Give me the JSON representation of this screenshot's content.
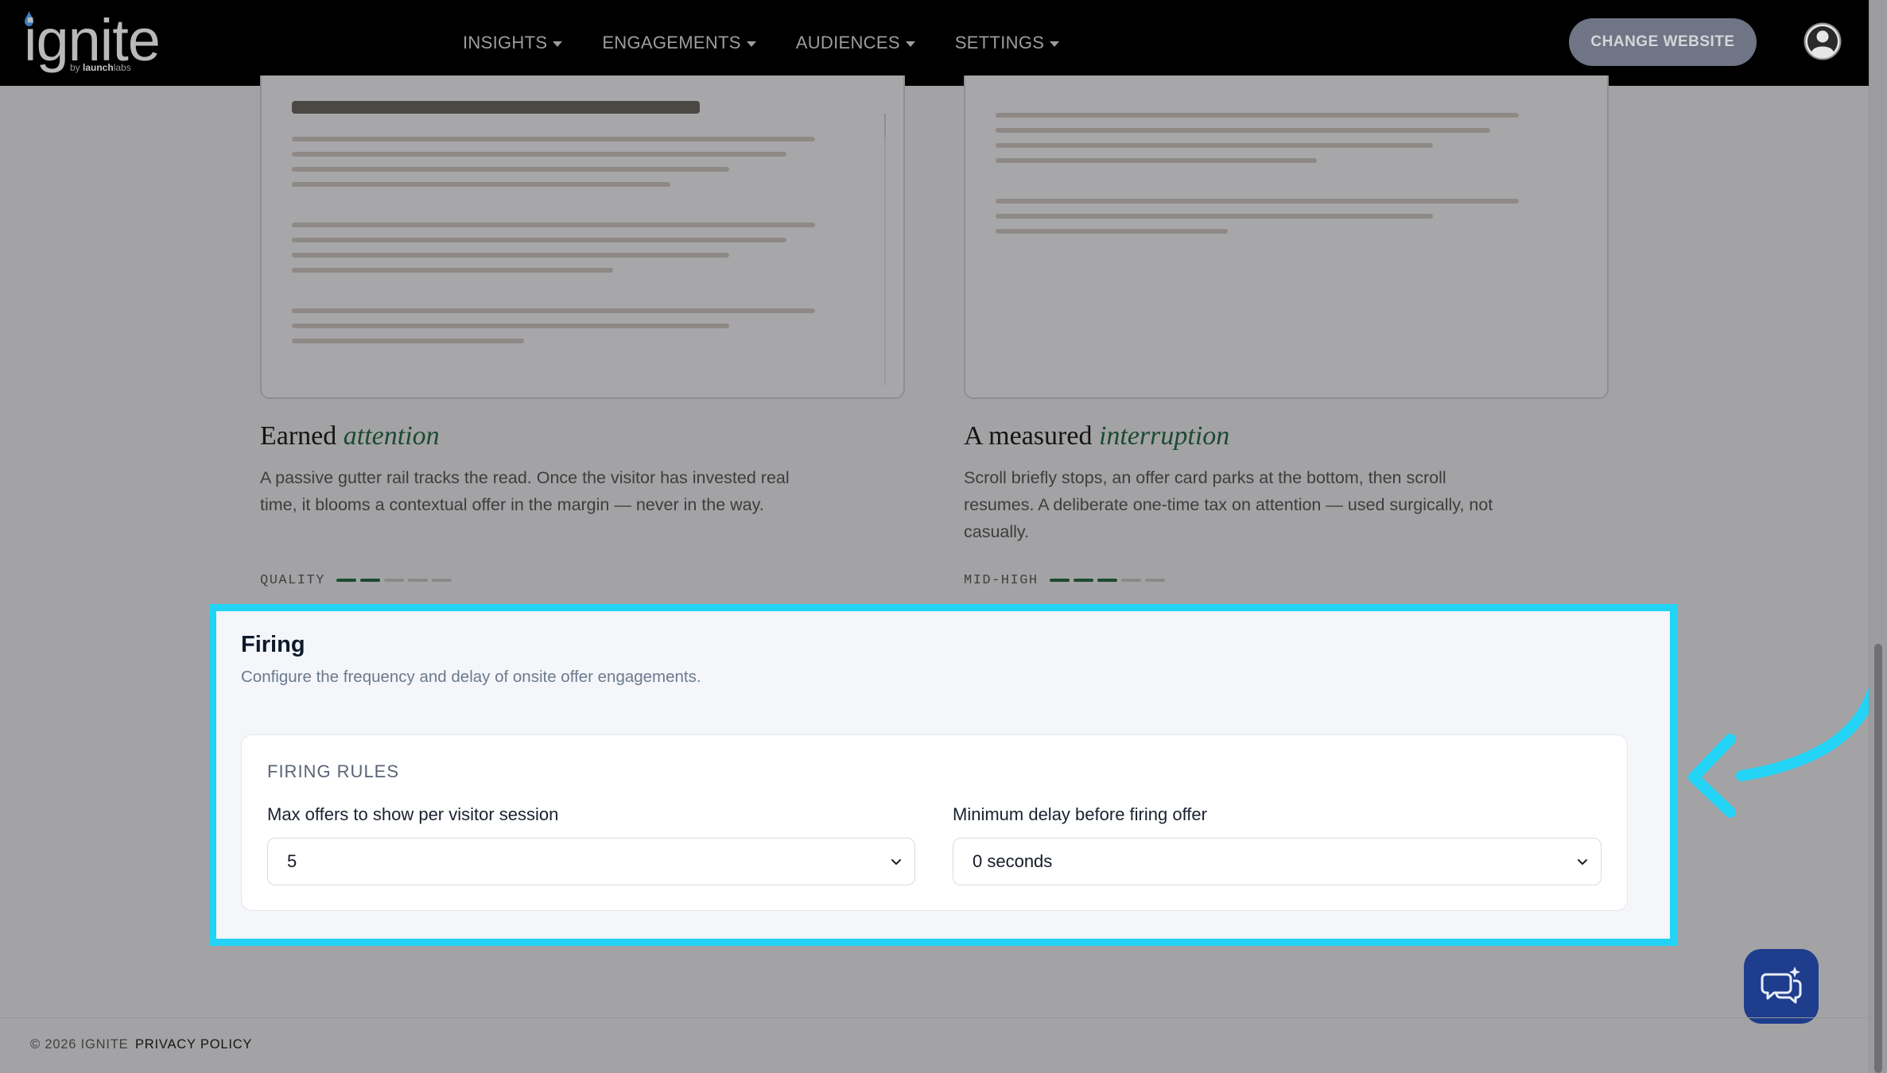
{
  "brand": {
    "logo_text": "ignite",
    "byline_prefix": "by ",
    "byline_brand": "launch",
    "byline_suffix": "labs"
  },
  "nav": {
    "items": [
      {
        "label": "INSIGHTS"
      },
      {
        "label": "ENGAGEMENTS"
      },
      {
        "label": "AUDIENCES"
      },
      {
        "label": "SETTINGS"
      }
    ],
    "change_website": "CHANGE WEBSITE"
  },
  "cards": [
    {
      "title_plain": "Earned ",
      "title_emphasis": "attention",
      "description": "A passive gutter rail tracks the read. Once the visitor has invested real time, it blooms a contextual offer in the margin — never in the way.",
      "meter_label": "QUALITY",
      "meter_level": 2,
      "meter_max": 5
    },
    {
      "title_plain": "A measured ",
      "title_emphasis": "interruption",
      "description": "Scroll briefly stops, an offer card parks at the bottom, then scroll resumes. A deliberate one-time tax on attention — used surgically, not casually.",
      "meter_label": "MID-HIGH",
      "meter_level": 3,
      "meter_max": 5
    }
  ],
  "firing": {
    "title": "Firing",
    "subtitle": "Configure the frequency and delay of onsite offer engagements.",
    "rules_heading": "FIRING RULES",
    "max_offers_label": "Max offers to show per visitor session",
    "max_offers_value": "5",
    "min_delay_label": "Minimum delay before firing offer",
    "min_delay_value": "0 seconds"
  },
  "footer": {
    "copyright": "© 2026 IGNITE",
    "privacy": "PRIVACY POLICY"
  },
  "colors": {
    "highlight": "#22d3f5",
    "accent_green": "#1c4a32",
    "chat_button": "#1e3d8c"
  }
}
